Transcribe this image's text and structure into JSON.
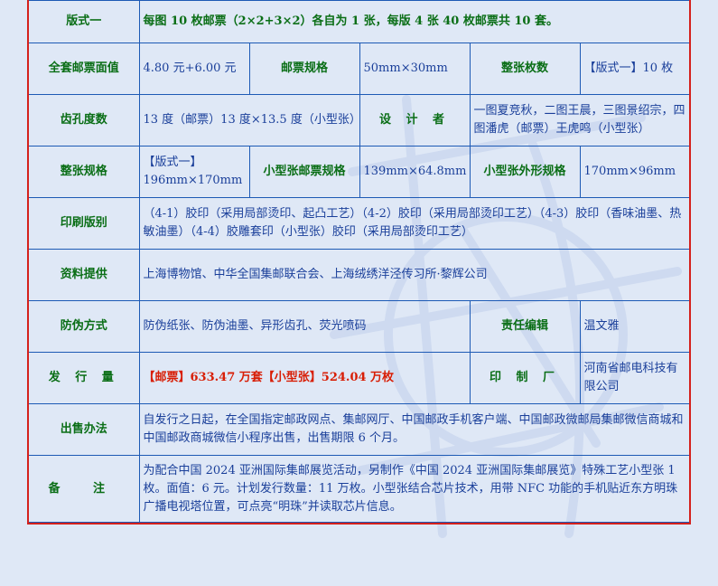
{
  "rows": {
    "format": {
      "label": "版式一",
      "value": "每图 10 枚邮票（2×2+3×2）各自为 1 张，每版 4 张 40 枚邮票共 10 套。"
    },
    "face_value": {
      "label": "全套邮票面值",
      "value": "4.80 元+6.00 元"
    },
    "stamp_spec": {
      "label": "邮票规格",
      "value": "50mm×30mm"
    },
    "sheet_count": {
      "label": "整张枚数",
      "value": "【版式一】10 枚"
    },
    "perforation": {
      "label": "齿孔度数",
      "value": "13 度（邮票）13 度×13.5 度（小型张）"
    },
    "designer": {
      "label": "设 计 者",
      "value": "一图夏竞秋，二图王晨，三图景绍宗，四图潘虎（邮票）王虎鸣（小型张）"
    },
    "sheet_spec": {
      "label": "整张规格",
      "value_line1": "【版式一】",
      "value_line2": "196mm×170mm"
    },
    "souvenir_spec": {
      "label": "小型张邮票规格",
      "value": "139mm×64.8mm"
    },
    "souvenir_outer": {
      "label": "小型张外形规格",
      "value": "170mm×96mm"
    },
    "printing": {
      "label": "印刷版别",
      "value": "（4-1）胶印（采用局部烫印、起凸工艺）（4-2）胶印（采用局部烫印工艺）（4-3）胶印（香味油墨、热敏油墨）（4-4）胶雕套印（小型张）胶印（采用局部烫印工艺）"
    },
    "materials": {
      "label": "资料提供",
      "value": "上海博物馆、中华全国集邮联合会、上海绒绣洋泾传习所·黎辉公司"
    },
    "anti_fake": {
      "label": "防伪方式",
      "value": "防伪纸张、防伪油墨、异形齿孔、荧光喷码"
    },
    "editor": {
      "label": "责任编辑",
      "value": "温文雅"
    },
    "issue_qty": {
      "label": "发 行 量",
      "value": "【邮票】633.47 万套【小型张】524.04 万枚"
    },
    "printer": {
      "label": "印 制 厂",
      "value": "河南省邮电科技有限公司"
    },
    "sales": {
      "label": "出售办法",
      "value": "自发行之日起，在全国指定邮政网点、集邮网厅、中国邮政手机客户端、中国邮政微邮局集邮微信商城和中国邮政商城微信小程序出售，出售期限 6 个月。"
    },
    "remarks": {
      "label": "备 注",
      "value": "为配合中国 2024 亚洲国际集邮展览活动，另制作《中国 2024 亚洲国际集邮展览》特殊工艺小型张 1 枚。面值：6 元。计划发行数量：11 万枚。小型张结合芯片技术，用带 NFC 功能的手机贴近东方明珠广播电视塔位置，可点亮“明珠”并读取芯片信息。"
    }
  },
  "colors": {
    "label": "#0a6e16",
    "value": "#1a3f9a",
    "highlight": "#d81e06",
    "grid": "#1d5ab5",
    "frame": "#d4201c",
    "background": "#dfe8f6"
  }
}
